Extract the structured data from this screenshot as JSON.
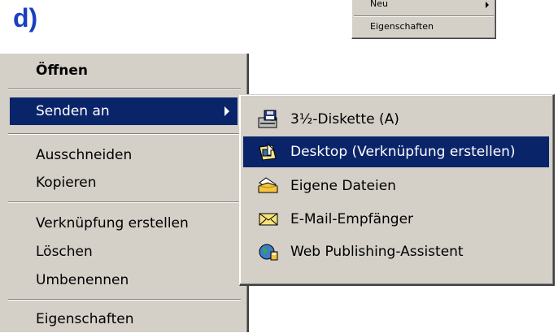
{
  "panel_label": "d)",
  "mini_menu": {
    "items": [
      {
        "label": "Neu",
        "has_submenu": true
      },
      {
        "label": "Eigenschaften",
        "has_submenu": false
      }
    ]
  },
  "context_menu": {
    "items": [
      {
        "label": "Öffnen",
        "bold": true
      },
      {
        "label": "Senden an",
        "selected": true,
        "has_submenu": true
      },
      {
        "label": "Ausschneiden"
      },
      {
        "label": "Kopieren"
      },
      {
        "label": "Verknüpfung erstellen"
      },
      {
        "label": "Löschen"
      },
      {
        "label": "Umbenennen"
      },
      {
        "label": "Eigenschaften"
      }
    ]
  },
  "send_to_submenu": {
    "items": [
      {
        "label": "3½-Diskette (A)",
        "icon": "floppy-drive-icon"
      },
      {
        "label": "Desktop (Verknüpfung erstellen)",
        "icon": "desktop-shortcut-icon",
        "selected": true
      },
      {
        "label": "Eigene Dateien",
        "icon": "my-documents-folder-icon"
      },
      {
        "label": "E-Mail-Empfänger",
        "icon": "mail-envelope-icon"
      },
      {
        "label": "Web Publishing-Assistent",
        "icon": "web-publishing-globe-icon"
      }
    ]
  },
  "colors": {
    "menu_bg": "#d4d0c8",
    "highlight": "#0a246a",
    "panel_label": "#1a3fbf"
  }
}
